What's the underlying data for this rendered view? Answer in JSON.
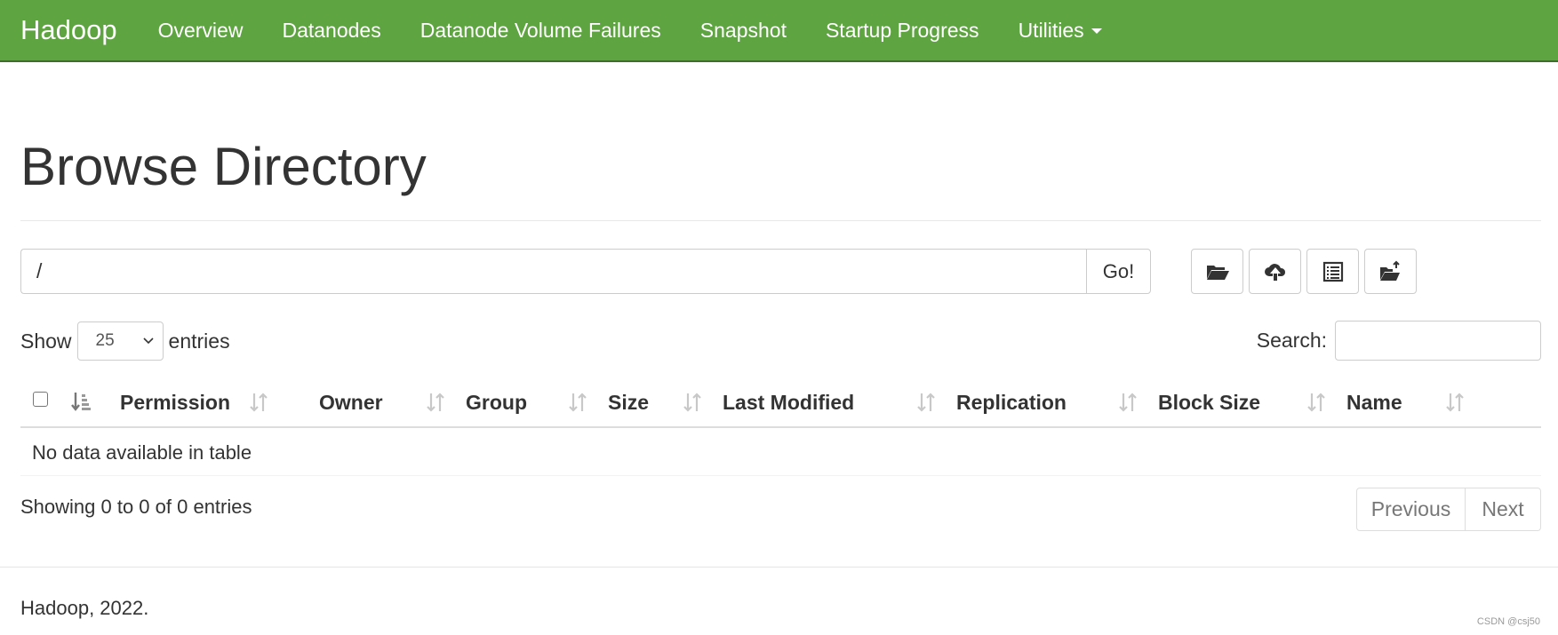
{
  "navbar": {
    "brand": "Hadoop",
    "items": [
      {
        "label": "Overview"
      },
      {
        "label": "Datanodes"
      },
      {
        "label": "Datanode Volume Failures"
      },
      {
        "label": "Snapshot"
      },
      {
        "label": "Startup Progress"
      },
      {
        "label": "Utilities"
      }
    ],
    "color": "#5ea440"
  },
  "page": {
    "title": "Browse Directory"
  },
  "path_bar": {
    "value": "/",
    "go_label": "Go!"
  },
  "toolbar": {
    "buttons": [
      {
        "icon": "folder-open-icon"
      },
      {
        "icon": "cloud-upload-icon"
      },
      {
        "icon": "list-alt-icon"
      },
      {
        "icon": "folder-move-icon"
      }
    ]
  },
  "length": {
    "prefix": "Show",
    "selected": "25",
    "suffix": "entries"
  },
  "search": {
    "label": "Search:",
    "value": ""
  },
  "table": {
    "columns": [
      "Permission",
      "Owner",
      "Group",
      "Size",
      "Last Modified",
      "Replication",
      "Block Size",
      "Name"
    ],
    "empty_message": "No data available in table",
    "info": "Showing 0 to 0 of 0 entries"
  },
  "pagination": {
    "previous": "Previous",
    "next": "Next"
  },
  "footer": {
    "text": "Hadoop, 2022."
  },
  "watermark": "CSDN @csj50"
}
